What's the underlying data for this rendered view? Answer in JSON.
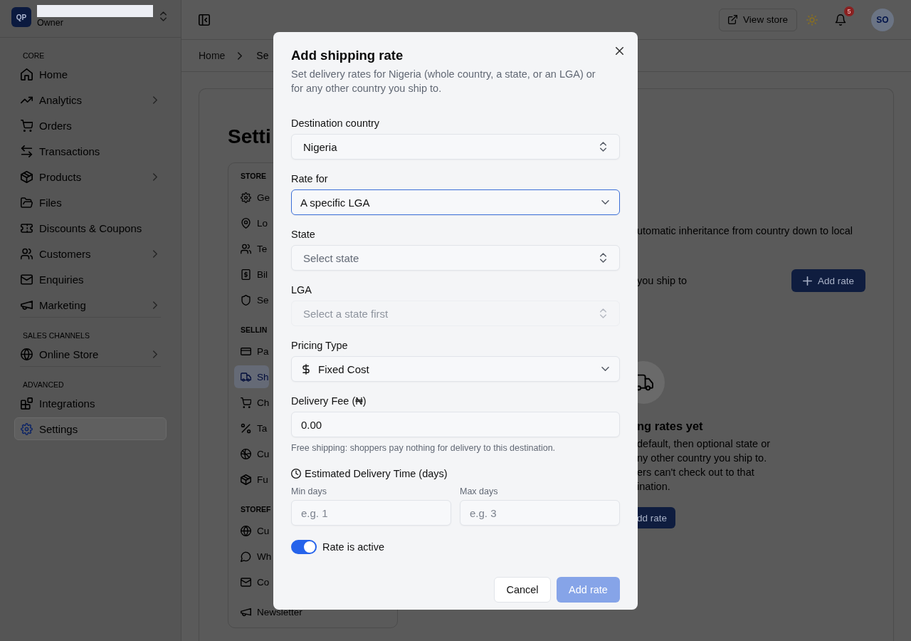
{
  "sidebar": {
    "logo": "QP",
    "role": "Owner",
    "sections": [
      {
        "label": "CORE",
        "items": [
          {
            "label": "Home",
            "submenu": false,
            "selected": false
          },
          {
            "label": "Analytics",
            "submenu": true,
            "selected": false
          },
          {
            "label": "Orders",
            "submenu": false,
            "selected": false
          },
          {
            "label": "Transactions",
            "submenu": false,
            "selected": false
          },
          {
            "label": "Products",
            "submenu": true,
            "selected": false
          },
          {
            "label": "Files",
            "submenu": false,
            "selected": false
          },
          {
            "label": "Discounts & Coupons",
            "submenu": false,
            "selected": false
          },
          {
            "label": "Customers",
            "submenu": true,
            "selected": false
          },
          {
            "label": "Enquiries",
            "submenu": false,
            "selected": false
          },
          {
            "label": "Marketing",
            "submenu": true,
            "selected": false
          }
        ]
      },
      {
        "label": "SALES CHANNELS",
        "items": [
          {
            "label": "Online Store",
            "submenu": true,
            "selected": false
          }
        ]
      },
      {
        "label": "ADVANCED",
        "items": [
          {
            "label": "Integrations",
            "submenu": false,
            "selected": false
          },
          {
            "label": "Settings",
            "submenu": false,
            "selected": true
          }
        ]
      }
    ]
  },
  "topbar": {
    "view_store": "View store",
    "notification_count": "5",
    "avatar": "SO"
  },
  "breadcrumb": [
    "Home",
    "Se"
  ],
  "page": {
    "title": "Setti",
    "settings_nav": [
      {
        "label": "STORE",
        "items": [
          {
            "label": "Ge",
            "selected": false
          },
          {
            "label": "Lo",
            "selected": false
          },
          {
            "label": "Te",
            "selected": false
          },
          {
            "label": "Bil",
            "selected": false
          },
          {
            "label": "Se",
            "selected": false
          }
        ]
      },
      {
        "label": "SELLIN",
        "items": [
          {
            "label": "Pa",
            "selected": false
          },
          {
            "label": "Sh",
            "selected": true
          },
          {
            "label": "Ch",
            "selected": false
          },
          {
            "label": "Ta",
            "selected": false
          },
          {
            "label": "Cu",
            "selected": false
          },
          {
            "label": "Fu",
            "selected": false
          }
        ]
      },
      {
        "label": "STOREF",
        "items": [
          {
            "label": "Cu",
            "selected": false
          },
          {
            "label": "Wh",
            "selected": false
          },
          {
            "label": "Co",
            "selected": false
          },
          {
            "label": "Newsletter",
            "selected": false
          }
        ]
      }
    ],
    "shipping": {
      "description": "utomatic inheritance from country down to local",
      "subtitle": "you ship to",
      "add_button": "Add rate",
      "empty_state": {
        "title": "ng rates yet",
        "lines": [
          "default, then optional state or",
          "ny other country you ship to.",
          "ers can't check out to that",
          "ination."
        ],
        "button": "dd rate"
      }
    }
  },
  "dialog": {
    "title": "Add shipping rate",
    "description": "Set delivery rates for Nigeria (whole country, a state, or an LGA) or for any other country you ship to.",
    "fields": [
      {
        "kind": "combobox",
        "label": "Destination country",
        "value": "Nigeria",
        "focused": false,
        "disabled": false
      },
      {
        "kind": "select",
        "label": "Rate for",
        "value": "A specific LGA",
        "focused": true,
        "disabled": false
      },
      {
        "kind": "combobox",
        "label": "State",
        "placeholder": "Select state",
        "focused": false,
        "disabled": false
      },
      {
        "kind": "combobox",
        "label": "LGA",
        "placeholder": "Select a state first",
        "focused": false,
        "disabled": true
      },
      {
        "kind": "icon-select",
        "label": "Pricing Type",
        "value": "Fixed Cost",
        "focused": false,
        "disabled": false
      },
      {
        "kind": "input",
        "label": "Delivery Fee (₦)",
        "value": "0.00",
        "hint": "Free shipping: shoppers pay nothing for delivery to this destination.",
        "focused": false,
        "disabled": false
      }
    ],
    "delivery_time": {
      "label": "Estimated Delivery Time (days)",
      "fields": [
        {
          "label": "Min days",
          "placeholder": "e.g. 1"
        },
        {
          "label": "Max days",
          "placeholder": "e.g. 3"
        }
      ]
    },
    "active_toggle": {
      "label": "Rate is active",
      "on": true
    },
    "buttons": [
      {
        "label": "Cancel",
        "kind": "secondary",
        "disabled": false
      },
      {
        "label": "Add rate",
        "kind": "primary",
        "disabled": true
      }
    ]
  }
}
